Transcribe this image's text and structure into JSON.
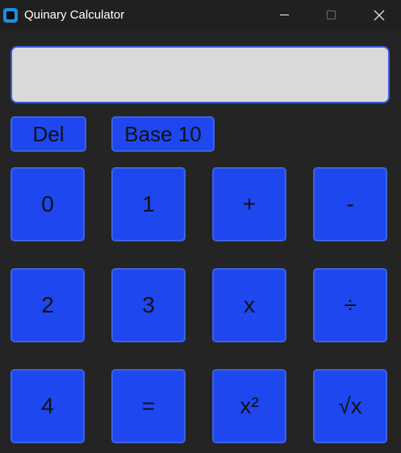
{
  "window": {
    "title": "Quinary Calculator"
  },
  "display": {
    "value": ""
  },
  "controls": {
    "delete_label": "Del",
    "base_label": "Base 10"
  },
  "keys": [
    "0",
    "1",
    "+",
    "-",
    "2",
    "3",
    "x",
    "÷",
    "4",
    "=",
    "x²",
    "√x"
  ],
  "colors": {
    "background": "#242424",
    "titlebar": "#202020",
    "button_fill": "#1f47f0",
    "button_border": "#3d62e0",
    "display_fill": "#d9d9d9",
    "display_border": "#3a5bd9"
  }
}
